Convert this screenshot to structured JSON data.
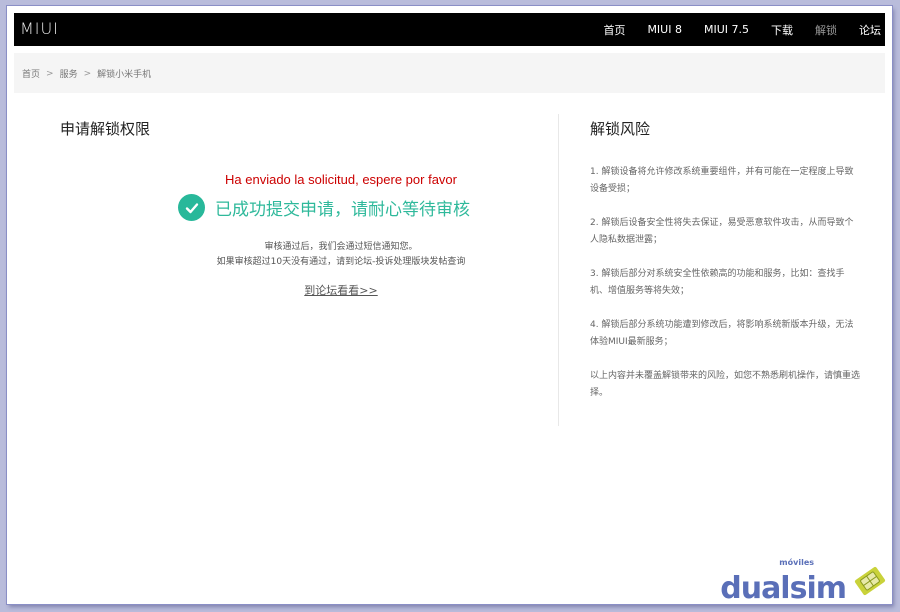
{
  "header": {
    "logo": "MIUI",
    "nav": [
      {
        "label": "首页",
        "active": false
      },
      {
        "label": "MIUI 8",
        "active": false
      },
      {
        "label": "MIUI 7.5",
        "active": false
      },
      {
        "label": "下载",
        "active": false
      },
      {
        "label": "解锁",
        "active": true
      },
      {
        "label": "论坛",
        "active": false
      }
    ]
  },
  "breadcrumb": {
    "items": [
      "首页",
      "服务",
      "解锁小米手机"
    ],
    "separator": ">"
  },
  "left": {
    "title": "申请解锁权限",
    "status_es": "Ha enviado la solicitud, espere por favor",
    "success_text": "已成功提交申请，请耐心等待审核",
    "info_line1": "审核通过后，我们会通过短信通知您。",
    "info_line2": "如果审核超过10天没有通过，请到论坛-投诉处理版块发帖查询",
    "forum_link": "到论坛看看>>"
  },
  "right": {
    "title": "解锁风险",
    "risks": [
      "1. 解锁设备将允许修改系统重要组件，并有可能在一定程度上导致设备受损；",
      "2. 解锁后设备安全性将失去保证，易受恶意软件攻击，从而导致个人隐私数据泄露；",
      "3. 解锁后部分对系统安全性依赖高的功能和服务，比如：查找手机、增值服务等将失效；",
      "4. 解锁后部分系统功能遭到修改后，将影响系统新版本升级，无法体验MIUI最新服务；",
      "以上内容并未覆盖解锁带来的风险，如您不熟悉刷机操作，请慎重选择。"
    ]
  },
  "watermark": {
    "brand": "dualsim",
    "sub": "móviles"
  },
  "colors": {
    "accent_green": "#2fb99b",
    "status_red": "#cc0000",
    "topbar": "#000000"
  }
}
